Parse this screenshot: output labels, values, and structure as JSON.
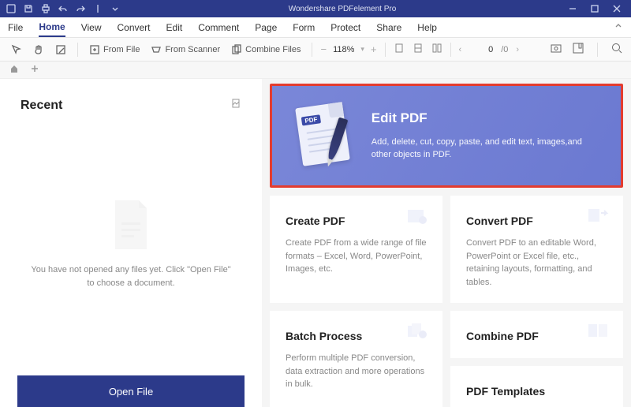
{
  "app": {
    "title": "Wondershare PDFelement Pro"
  },
  "menu": {
    "file": "File",
    "home": "Home",
    "view": "View",
    "convert": "Convert",
    "edit": "Edit",
    "comment": "Comment",
    "page": "Page",
    "form": "Form",
    "protect": "Protect",
    "share": "Share",
    "help": "Help"
  },
  "toolbar": {
    "from_file": "From File",
    "from_scanner": "From Scanner",
    "combine_files": "Combine Files",
    "zoom": "118%",
    "page_current": "0",
    "page_total": "/0"
  },
  "recent": {
    "heading": "Recent",
    "empty": "You have not opened any files yet. Click \"Open File\" to choose a document.",
    "open_btn": "Open File"
  },
  "hero": {
    "title": "Edit PDF",
    "desc": "Add, delete, cut, copy, paste, and edit text, images,and other objects in PDF.",
    "badge": "PDF"
  },
  "cards": {
    "create": {
      "title": "Create PDF",
      "desc": "Create PDF from a wide range of file formats – Excel, Word, PowerPoint, Images, etc."
    },
    "convert": {
      "title": "Convert PDF",
      "desc": "Convert PDF to an editable Word, PowerPoint or Excel file, etc., retaining layouts, formatting, and tables."
    },
    "batch": {
      "title": "Batch Process",
      "desc": "Perform multiple PDF conversion, data extraction and more operations in bulk."
    },
    "combine": {
      "title": "Combine PDF"
    },
    "templates": {
      "title": "PDF Templates"
    }
  }
}
